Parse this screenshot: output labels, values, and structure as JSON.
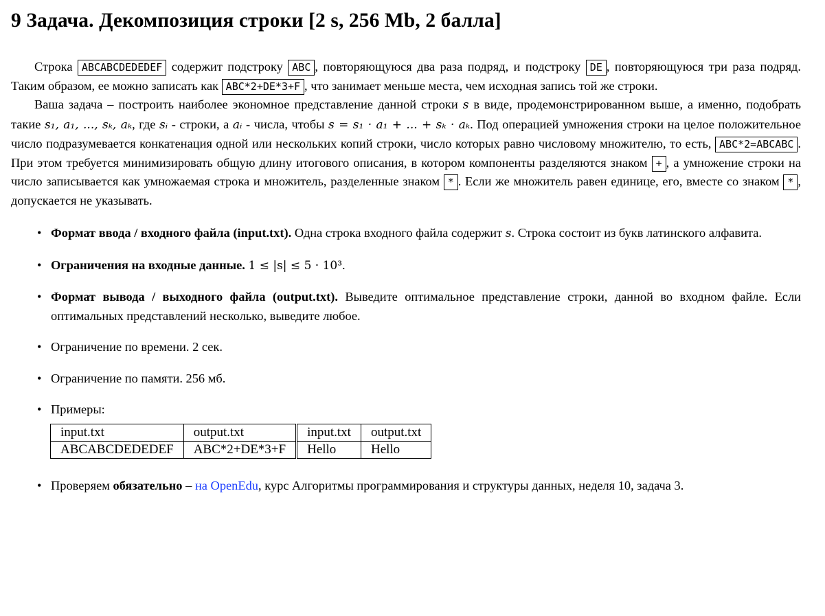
{
  "title": "9 Задача. Декомпозиция строки [2 s, 256 Mb, 2 балла]",
  "p1": {
    "t1": "Строка",
    "c1": "ABCABCDEDEDEF",
    "t2": "содержит подстроку",
    "c2": "ABC",
    "t3": ", повторяющуюся два раза подряд, и подстроку",
    "c3": "DE",
    "t4": ", повторяющуюся три раза подряд. Таким образом, ее можно записать как",
    "c4": "ABC*2+DE*3+F",
    "t5": ", что занимает меньше места, чем исходная запись той же строки."
  },
  "p2": {
    "t1": "Ваша задача – построить наиболее экономное представление данной строки",
    "v_s": "s",
    "t2": "в виде, продемонстрированном выше, а именно, подобрать такие",
    "list": "s₁, a₁, ..., sₖ, aₖ",
    "t3": ", где",
    "v_si": "sᵢ",
    "t4": "- строки, а",
    "v_ai": "aᵢ",
    "t5": "- числа, чтобы",
    "formula": "s = s₁ · a₁ + ... + sₖ · aₖ",
    "t6": ". Под операцией умножения строки на целое положительное число подразумевается конкатенация одной или нескольких копий строки, число которых равно числовому множителю, то есть,",
    "c1": "ABC*2=ABCABC",
    "t7": ". При этом требуется минимизировать общую длину итогового описания, в котором компоненты разделяются знаком",
    "c2": "+",
    "t8": ", а умножение строки на число записывается как умножаемая строка и множитель, разделенные знаком",
    "c3": "*",
    "t9": ". Если же множитель равен единице, его, вместе со знаком",
    "c4": "*",
    "t10": ", допускается не указывать."
  },
  "items": {
    "input": {
      "bold": "Формат ввода / входного файла (input.txt).",
      "t1": "Одна строка входного файла содержит",
      "v_s": "s",
      "t2": ". Строка состоит из букв латинского алфавита."
    },
    "limits": {
      "bold": "Ограничения на входные данные.",
      "formula": "1 ≤ |s| ≤ 5 · 10³",
      "t1": "."
    },
    "output": {
      "bold": "Формат вывода / выходного файла (output.txt).",
      "t1": "Выведите оптимальное представление строки, данной во входном файле. Если оптимальных представлений несколько, выведите любое."
    },
    "time": "Ограничение по времени. 2 сек.",
    "memory": "Ограничение по памяти. 256 мб.",
    "examples": "Примеры:",
    "check": {
      "t1": "Проверяем",
      "bold": "обязательно",
      "t2": "–",
      "link": "на OpenEdu",
      "t3": ", курс Алгоритмы программирования и структуры данных, неделя 10, задача 3."
    }
  },
  "table": {
    "h": [
      "input.txt",
      "output.txt",
      "input.txt",
      "output.txt"
    ],
    "r": [
      "ABCABCDEDEDEF",
      "ABC*2+DE*3+F",
      "Hello",
      "Hello"
    ]
  },
  "bullet": "•"
}
